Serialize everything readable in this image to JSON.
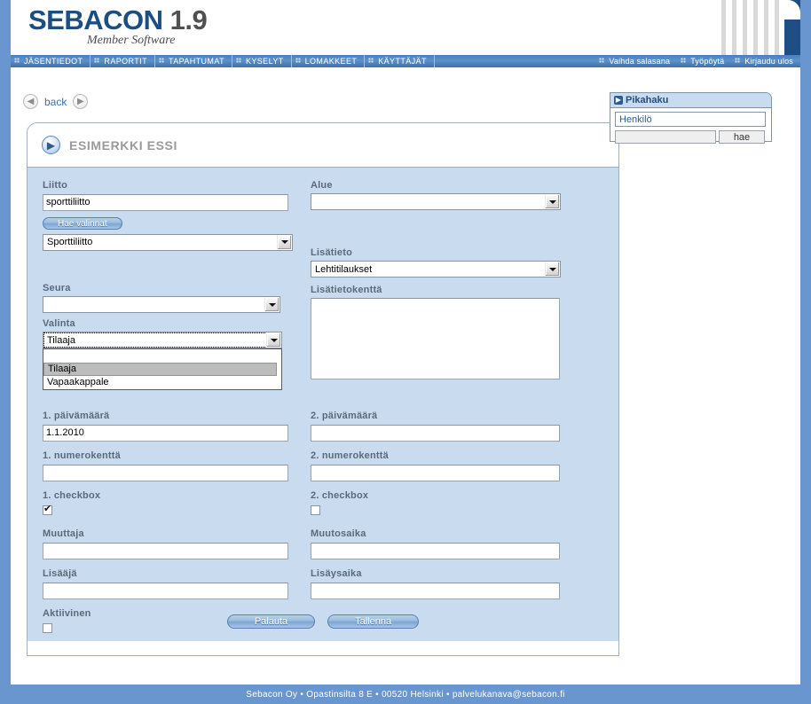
{
  "app": {
    "logo_name": "SEBACON",
    "logo_version": "1.9",
    "logo_subtitle": "Member Software"
  },
  "nav": {
    "primary": [
      {
        "label": "JÄSENTIEDOT"
      },
      {
        "label": "RAPORTIT"
      },
      {
        "label": "TAPAHTUMAT"
      },
      {
        "label": "KYSELYT"
      },
      {
        "label": "LOMAKKEET"
      },
      {
        "label": "KÄYTTÄJÄT"
      }
    ],
    "secondary": [
      {
        "label": "Vaihda salasana"
      },
      {
        "label": "Työpöytä"
      },
      {
        "label": "Kirjaudu ulos"
      }
    ]
  },
  "back_bar": {
    "label": "back",
    "prev_icon": "arrow-left-circle-icon",
    "next_icon": "arrow-right-circle-icon"
  },
  "panel": {
    "title": "ESIMERKKI ESSI",
    "title_icon": "arrow-right-circle-icon"
  },
  "form": {
    "liitto": {
      "label": "Liitto",
      "value": "sporttiliitto",
      "button_label": "Hae valinnat",
      "select_value": "Sporttiliitto"
    },
    "alue": {
      "label": "Alue",
      "select_value": ""
    },
    "seura": {
      "label": "Seura",
      "select_value": ""
    },
    "lisatieto": {
      "label": "Lisätieto",
      "select_value": "Lehtitilaukset"
    },
    "valinta": {
      "label": "Valinta",
      "select_value": "Tilaaja",
      "open": true,
      "options": [
        "",
        "Tilaaja",
        "Vapaakappale"
      ],
      "selected_index": 1
    },
    "lisatietokentta": {
      "label": "Lisätietokenttä",
      "value": ""
    },
    "paivamaara1": {
      "label": "1. päivämäärä",
      "value": "1.1.2010"
    },
    "paivamaara2": {
      "label": "2. päivämäärä",
      "value": ""
    },
    "numerokentta1": {
      "label": "1. numerokenttä",
      "value": ""
    },
    "numerokentta2": {
      "label": "2. numerokenttä",
      "value": ""
    },
    "checkbox1": {
      "label": "1. checkbox",
      "checked": true
    },
    "checkbox2": {
      "label": "2. checkbox",
      "checked": false
    },
    "muuttaja": {
      "label": "Muuttaja",
      "value": ""
    },
    "muutosaika": {
      "label": "Muutosaika",
      "value": ""
    },
    "lisaaja": {
      "label": "Lisääjä",
      "value": ""
    },
    "lisaysaika": {
      "label": "Lisäysaika",
      "value": ""
    },
    "aktiivinen": {
      "label": "Aktiivinen",
      "checked": false
    },
    "actions": {
      "reset_label": "Palauta",
      "save_label": "Tallenna"
    }
  },
  "quick_search": {
    "title": "Pikahaku",
    "title_icon": "arrow-right-square-icon",
    "type_value": "Henkilö",
    "query_value": "",
    "search_label": "hae"
  },
  "footer": {
    "text": "Sebacon Oy • Opastinsilta 8 E • 00520 Helsinki • palvelukanava@sebacon.fi"
  },
  "colors": {
    "brand_blue": "#1b4f82",
    "rail_blue": "#6a96cf",
    "form_blue": "#c9dcef",
    "nav_blue": "#4a7fbd"
  }
}
